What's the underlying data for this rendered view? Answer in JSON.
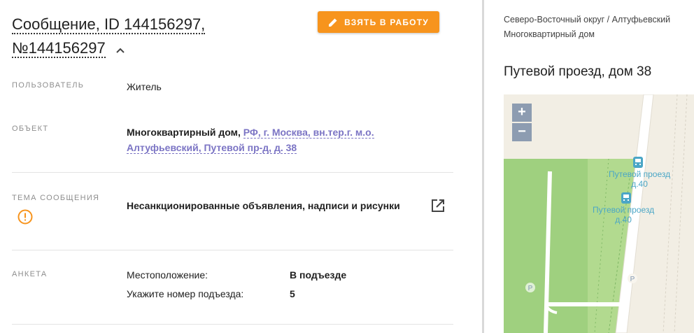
{
  "header": {
    "title": "Сообщение, ID 144156297,",
    "title_number": "№144156297",
    "take_button_label": "ВЗЯТЬ В РАБОТУ"
  },
  "fields": {
    "user_label": "ПОЛЬЗОВАТЕЛЬ",
    "user_value": "Житель",
    "object_label": "ОБЪЕКТ",
    "object_type": "Многоквартирный дом,",
    "object_address_line1": "РФ, г. Москва, вн.тер.г. м.о.",
    "object_address_line2": "Алтуфьевский, Путевой пр-д, д. 38",
    "topic_label": "ТЕМА СООБЩЕНИЯ",
    "topic_value": "Несанкционированные объявления, надписи и рисунки",
    "form_label": "АНКЕТА",
    "form_rows": [
      {
        "key": "Местоположение:",
        "value": "В подъезде"
      },
      {
        "key": "Укажите номер подъезда:",
        "value": "5"
      }
    ]
  },
  "side": {
    "breadcrumb_line1": "Северо-Восточный округ / Алтуфьевский",
    "breadcrumb_line2": "Многоквартирный дом",
    "address": "Путевой проезд, дом 38"
  },
  "map": {
    "zoom_in": "+",
    "zoom_out": "−",
    "stop1_line1": "Путевой проезд",
    "stop1_line2": "д.40",
    "stop2_line1": "Путевой проезд",
    "stop2_line2": "д.40",
    "parking": "P"
  },
  "colors": {
    "accent": "#f7941d",
    "link": "#7b74c4",
    "label": "#8e8e8e",
    "map_green": "#9fd07f",
    "map_bg": "#f2eee4"
  },
  "icons": [
    "chevron-up-icon",
    "pencil-icon",
    "warning-circle-icon",
    "external-link-icon",
    "bus-stop-icon",
    "parking-icon"
  ]
}
